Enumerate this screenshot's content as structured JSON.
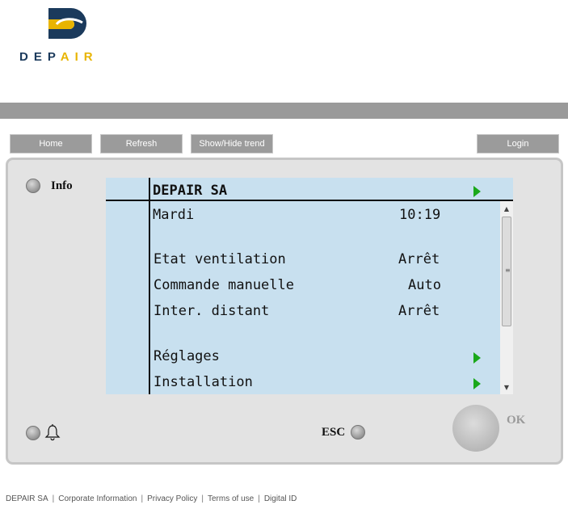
{
  "brand": {
    "name_dep": "DEP",
    "name_air": "AIR",
    "colors": {
      "navy": "#1b3a5c",
      "yellow": "#e8b400"
    }
  },
  "nav": {
    "home_label": "Home",
    "refresh_label": "Refresh",
    "trend_label": "Show/Hide trend",
    "login_label": "Login"
  },
  "panel": {
    "info_label": "Info",
    "esc_label": "ESC",
    "ok_label": "OK",
    "bell_icon": "bell-icon"
  },
  "screen": {
    "header": "DEPAIR SA",
    "day": "Mardi",
    "time": "10:19",
    "rows": [
      {
        "label": "Etat ventilation",
        "value": "Arrêt"
      },
      {
        "label": "Commande manuelle",
        "value": "Auto"
      },
      {
        "label": "Inter. distant",
        "value": "Arrêt"
      }
    ],
    "menus": [
      {
        "label": "Réglages"
      },
      {
        "label": "Installation"
      }
    ],
    "arrow_color": "#1aa81a",
    "background": "#c8e0ef"
  },
  "footer": {
    "links": [
      "DEPAIR SA",
      "Corporate Information",
      "Privacy Policy",
      "Terms of use",
      "Digital ID"
    ]
  }
}
